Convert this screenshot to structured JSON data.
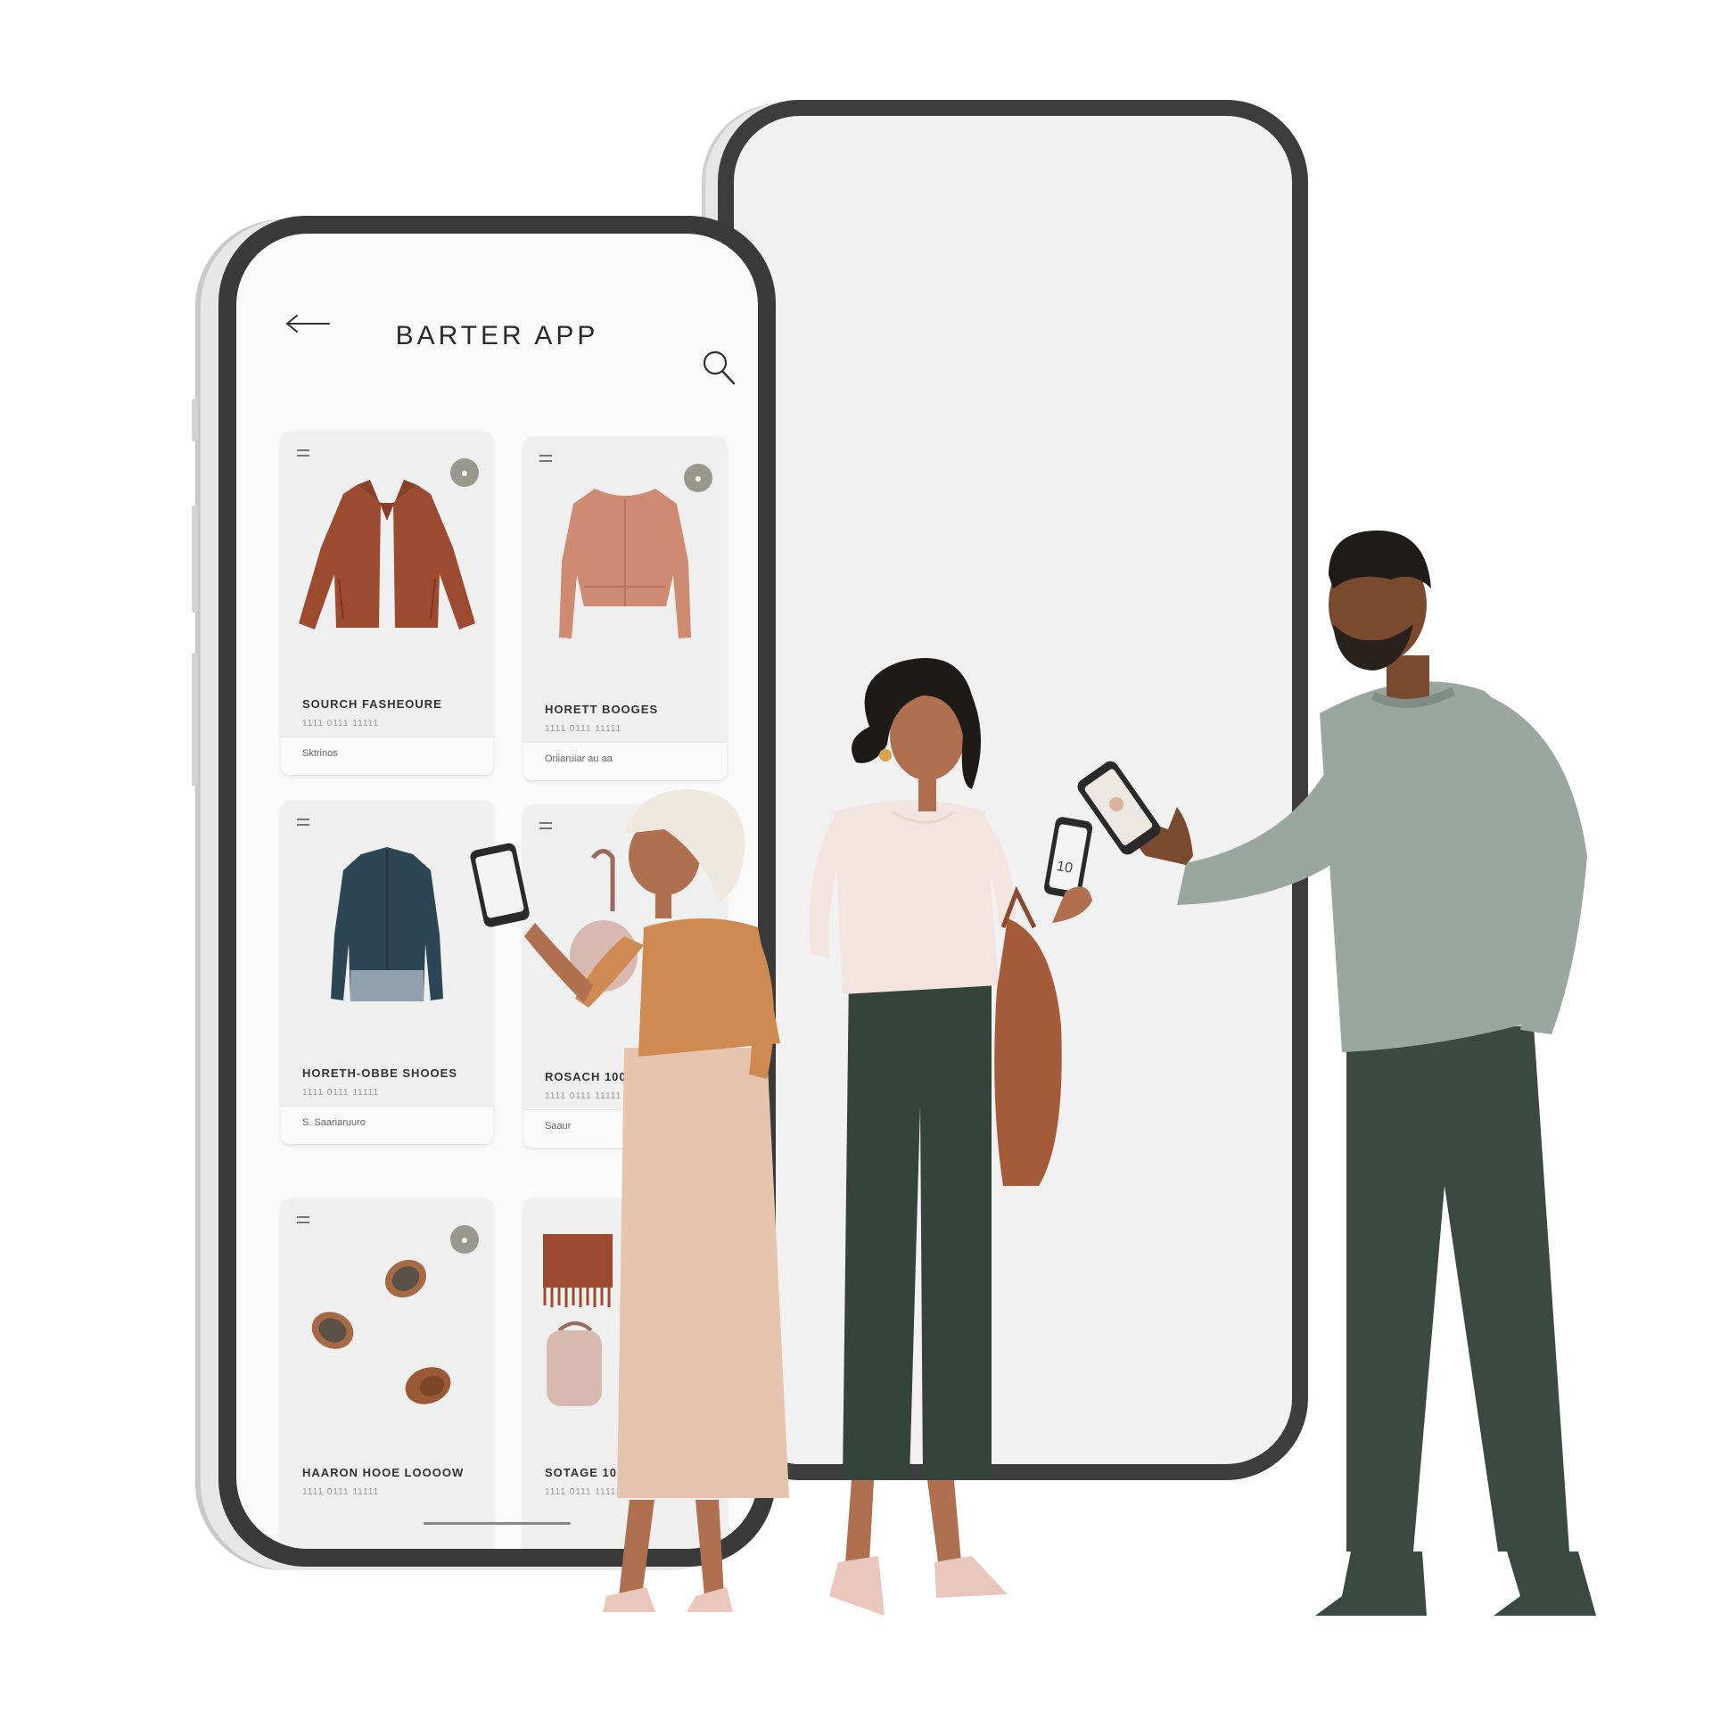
{
  "app": {
    "title": "BARTER APP"
  },
  "icons": {
    "back": "back-arrow-icon",
    "search": "search-icon",
    "card_menu": "menu-icon",
    "badge": "badge-icon"
  },
  "colors": {
    "phone_frame": "#3d3d3d",
    "screen": "#fafafa",
    "card": "#efefef",
    "badge": "#9a988d",
    "rust": "#9c4a30",
    "blush": "#cf8a72",
    "denim": "#2c4656",
    "sage": "#9aa79f",
    "forest": "#3a4a42"
  },
  "listings": [
    {
      "title": "SOURCH FASHEOURE",
      "subtitle": "1111 0111 11111",
      "footer": "Sktrinos"
    },
    {
      "title": "HORETT BOOGES",
      "subtitle": "1111 0111 11111",
      "footer": "Oriiaruiar au aa"
    },
    {
      "title": "HORETH-OBBE SHOOES",
      "subtitle": "1111 0111 11111",
      "footer": "S. Saariaruuro"
    },
    {
      "title": "ROSACH 100",
      "subtitle": "1111 0111 11111",
      "footer": "Saaur"
    },
    {
      "title": "HAARON HOOE LOOOOW",
      "subtitle": "1111 0111 11111"
    },
    {
      "title": "SOTAGE 100",
      "subtitle": "1111 0111 11111"
    }
  ],
  "held_phone_text": "10"
}
